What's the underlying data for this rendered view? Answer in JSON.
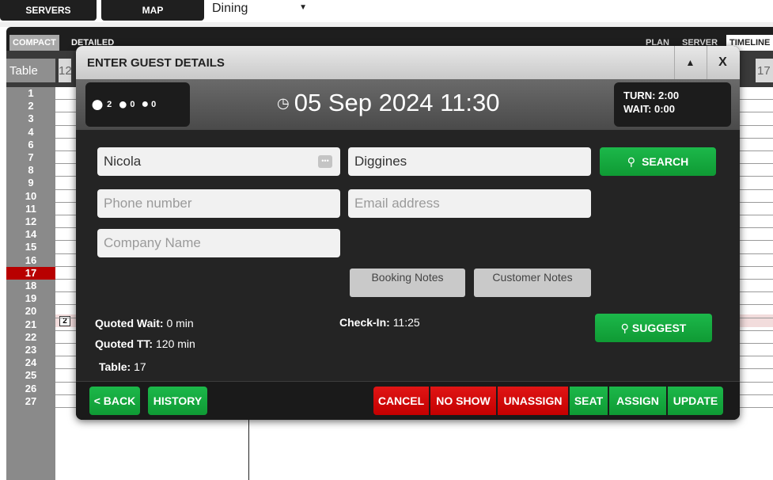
{
  "topbar": {
    "servers_label": "SERVERS",
    "map_label": "MAP",
    "area_select": "Dining"
  },
  "viewbar": {
    "compact_label": "COMPACT",
    "detailed_label": "DETAILED",
    "plan_label": "PLAN",
    "server_label": "SERVER",
    "timeline_label": "TIMELINE"
  },
  "grid": {
    "table_header": "Table",
    "time_left": "12",
    "time_right": "17",
    "rows": [
      "1",
      "2",
      "3",
      "4",
      "6",
      "7",
      "8",
      "9",
      "10",
      "11",
      "12",
      "14",
      "15",
      "16",
      "17",
      "18",
      "19",
      "20",
      "21",
      "22",
      "23",
      "24",
      "25",
      "26",
      "27"
    ],
    "selected_badge": "2"
  },
  "modal": {
    "title": "ENTER GUEST DETAILS",
    "collapse_icon": "chevron-up-icon",
    "close_label": "X",
    "party": {
      "adults": "2",
      "children": "0",
      "babies": "0"
    },
    "datetime": "05 Sep 2024 11:30",
    "turn": "TURN: 2:00",
    "wait": "WAIT: 0:00",
    "first_name": "Nicola",
    "last_name": "Diggines",
    "phone_placeholder": "Phone number",
    "email_placeholder": "Email address",
    "company_placeholder": "Company Name",
    "search_label": "SEARCH",
    "booking_notes_label": "Booking Notes",
    "customer_notes_label": "Customer Notes",
    "suggest_label": "SUGGEST",
    "quoted_wait_label": "Quoted Wait:",
    "quoted_wait_value": "0 min",
    "quoted_tt_label": "Quoted TT:",
    "quoted_tt_value": "120 min",
    "table_label": "Table:",
    "table_value": "17",
    "checkin_label": "Check-In:",
    "checkin_value": "11:25"
  },
  "footer": {
    "back_label": "< BACK",
    "history_label": "HISTORY",
    "cancel_label": "CANCEL",
    "noshow_label": "NO SHOW",
    "unassign_label": "UNASSIGN",
    "seat_label": "SEAT",
    "assign_label": "ASSIGN",
    "update_label": "UPDATE"
  },
  "colors": {
    "red": "#c40000",
    "green": "#0f9a34",
    "dark": "#242424"
  }
}
